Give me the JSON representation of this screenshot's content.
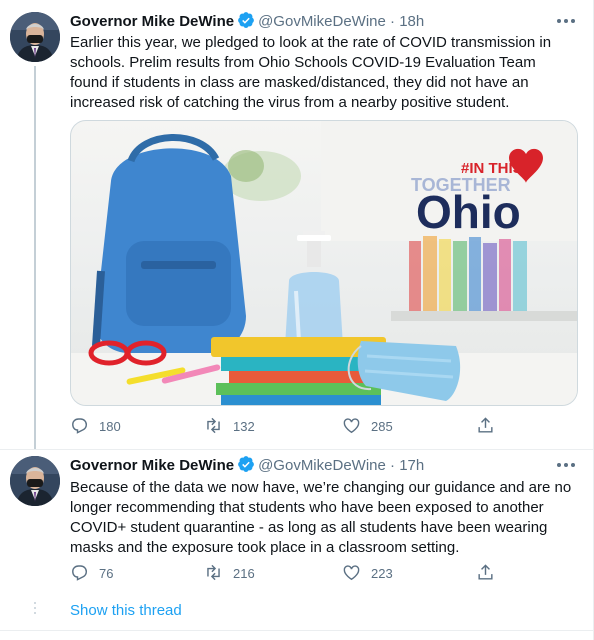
{
  "tweets": [
    {
      "author_name": "Governor Mike DeWine",
      "handle": "@GovMikeDeWine",
      "separator": "·",
      "time": "18h",
      "text": "Earlier this year, we pledged to look at the rate of COVID transmission in schools. Prelim results from Ohio Schools COVID-19 Evaluation Team found if students in class are masked/distanced, they did not have an increased risk of catching the virus from a nearby positive student.",
      "media": {
        "hashtag_text": "#IN THIS",
        "together_text": "TOGETHER",
        "ohio_text": "Ohio"
      },
      "replies": "180",
      "retweets": "132",
      "likes": "285"
    },
    {
      "author_name": "Governor Mike DeWine",
      "handle": "@GovMikeDeWine",
      "separator": "·",
      "time": "17h",
      "text": "Because of the data we now have, we’re changing our guidance and are no longer recommending that students who have been exposed to another COVID+ student quarantine - as long as all students have been wearing masks and the exposure took place in a classroom setting.",
      "replies": "76",
      "retweets": "216",
      "likes": "223"
    }
  ],
  "show_thread_label": "Show this thread",
  "colors": {
    "accent": "#1da1f2",
    "muted": "#5b7083",
    "ohio_navy": "#1d2d5c",
    "ohio_red": "#d8232a"
  },
  "icons": [
    "verified-badge-icon",
    "more-options-icon",
    "reply-icon",
    "retweet-icon",
    "like-icon",
    "share-icon"
  ]
}
